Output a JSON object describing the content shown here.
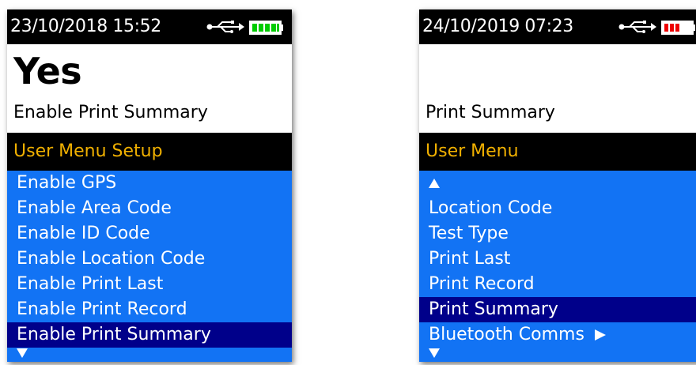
{
  "left_screen": {
    "datetime": "23/10/2018  15:52",
    "usb_icon": "usb-icon",
    "battery_icon": "battery-full-icon",
    "battery_color": "#00cc00",
    "value": "Yes",
    "value_description": "Enable Print Summary",
    "menu_title": "User Menu Setup",
    "items": [
      {
        "label": "Enable GPS",
        "selected": false
      },
      {
        "label": "Enable Area Code",
        "selected": false
      },
      {
        "label": "Enable ID Code",
        "selected": false
      },
      {
        "label": "Enable Location Code",
        "selected": false
      },
      {
        "label": "Enable Print Last",
        "selected": false
      },
      {
        "label": "Enable Print Record",
        "selected": false
      },
      {
        "label": "Enable Print Summary",
        "selected": true
      }
    ],
    "more_below_icon": "down-triangle-icon"
  },
  "right_screen": {
    "datetime": "24/10/2019  07:23",
    "usb_icon": "usb-icon",
    "battery_icon": "battery-low-icon",
    "battery_color": "#ee0000",
    "value": "",
    "value_description": "Print Summary",
    "menu_title": "User Menu",
    "more_above_icon": "up-triangle-icon",
    "items": [
      {
        "label": "Location Code",
        "selected": false
      },
      {
        "label": "Test Type",
        "selected": false
      },
      {
        "label": "Print Last",
        "selected": false
      },
      {
        "label": "Print Record",
        "selected": false
      },
      {
        "label": "Print Summary",
        "selected": true
      },
      {
        "label": "Bluetooth Comms",
        "selected": false,
        "submenu_icon": "right-triangle-icon"
      }
    ],
    "more_below_icon": "down-triangle-icon"
  },
  "colors": {
    "menu_bg": "#1273f4",
    "selected_bg": "#00008a",
    "title_text": "#f0b000"
  }
}
